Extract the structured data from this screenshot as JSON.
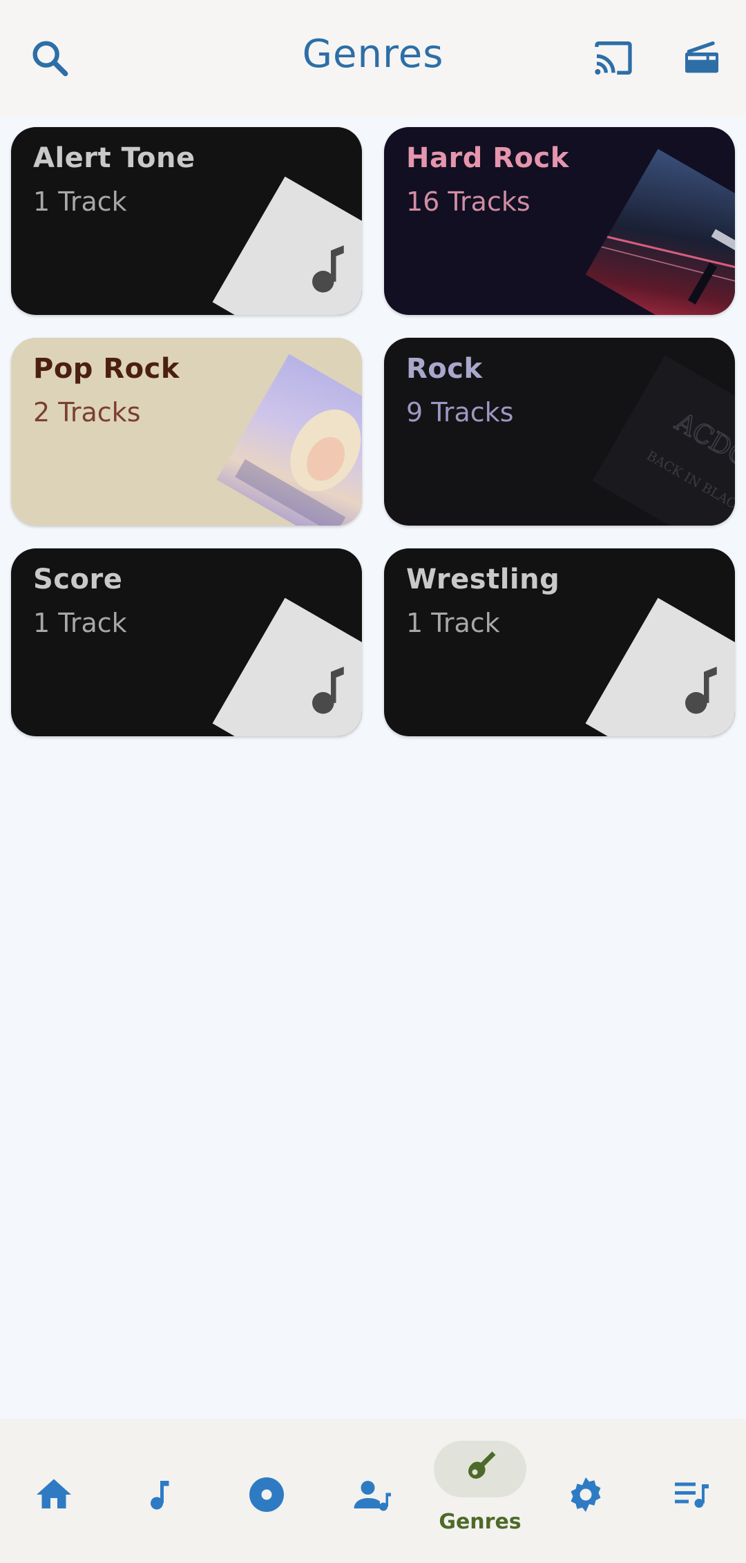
{
  "header": {
    "title": "Genres",
    "icons": [
      "search-icon",
      "cast-icon",
      "radio-icon"
    ]
  },
  "genres": [
    {
      "name": "Alert Tone",
      "count": "1 Track",
      "bg": "#121212",
      "name_color": "#c9c9c9",
      "count_color": "#a8a8a8",
      "art": "music-note-placeholder"
    },
    {
      "name": "Hard Rock",
      "count": "16 Tracks",
      "bg": "#120f22",
      "name_color": "#e595ad",
      "count_color": "#d18da3",
      "art": "album-art-red-blue"
    },
    {
      "name": "Pop Rock",
      "count": "2 Tracks",
      "bg": "#ddd3b9",
      "name_color": "#4b1f12",
      "count_color": "#7b3f30",
      "art": "album-art-lavender"
    },
    {
      "name": "Rock",
      "count": "9 Tracks",
      "bg": "#131316",
      "name_color": "#aaa7cc",
      "count_color": "#9c98c2",
      "art": "album-art-dark"
    },
    {
      "name": "Score",
      "count": "1 Track",
      "bg": "#121212",
      "name_color": "#c9c9c9",
      "count_color": "#a8a8a8",
      "art": "music-note-placeholder"
    },
    {
      "name": "Wrestling",
      "count": "1 Track",
      "bg": "#121212",
      "name_color": "#c9c9c9",
      "count_color": "#a8a8a8",
      "art": "music-note-placeholder"
    }
  ],
  "bottom_nav": {
    "items": [
      "home-icon",
      "music-note-icon",
      "album-icon",
      "artist-icon",
      "guitar-icon",
      "settings-icon",
      "playlist-icon"
    ],
    "active_label": "Genres",
    "active_color": "#4d6a2a",
    "icon_color": "#2e7bc4"
  }
}
